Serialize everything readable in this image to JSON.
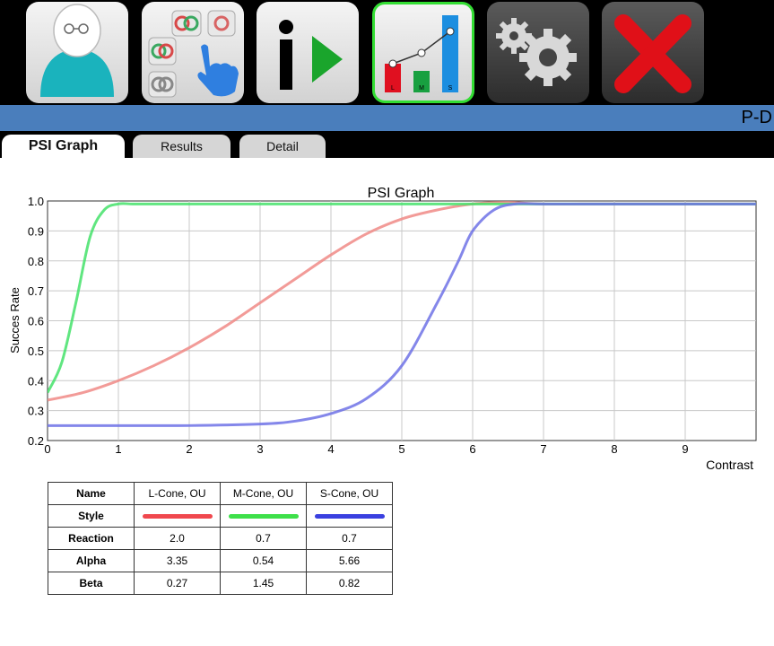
{
  "toolbar": {
    "buttons": [
      {
        "name": "patient-button",
        "icon": "patient-icon"
      },
      {
        "name": "test-select-button",
        "icon": "test-select-icon"
      },
      {
        "name": "info-play-button",
        "icon": "info-play-icon"
      },
      {
        "name": "graph-button",
        "icon": "bar-graph-icon",
        "active": true
      },
      {
        "name": "settings-button",
        "icon": "gears-icon"
      },
      {
        "name": "close-button",
        "icon": "close-icon"
      }
    ],
    "graph_icon_labels": [
      "L",
      "M",
      "S"
    ]
  },
  "header_bar": {
    "text": "P-D"
  },
  "tabs": [
    {
      "label": "PSI Graph",
      "active": true
    },
    {
      "label": "Results"
    },
    {
      "label": "Detail"
    }
  ],
  "colors": {
    "accent_blue": "#4a7ebc",
    "active_border": "#33dd33",
    "l_cone": "#f08a86",
    "m_cone": "#44e26a",
    "s_cone": "#6e72e6"
  },
  "chart_data": {
    "type": "line",
    "title": "PSI Graph",
    "xlabel": "Contrast",
    "ylabel": "Succes Rate",
    "xlim": [
      0,
      10
    ],
    "ylim": [
      0.2,
      1.0
    ],
    "xticks": [
      "0",
      "1",
      "2",
      "3",
      "4",
      "5",
      "6",
      "7",
      "8",
      "9"
    ],
    "yticks": [
      "0.2",
      "0.3",
      "0.4",
      "0.5",
      "0.6",
      "0.7",
      "0.8",
      "0.9",
      "1.0"
    ],
    "grid": true,
    "series": [
      {
        "name": "L-Cone, OU",
        "color": "#f08a86",
        "x": [
          0,
          0.5,
          1,
          1.5,
          2,
          2.5,
          3,
          3.5,
          4,
          4.5,
          5,
          5.5,
          6,
          6.5,
          7,
          8,
          10
        ],
        "y": [
          0.335,
          0.36,
          0.4,
          0.45,
          0.51,
          0.58,
          0.66,
          0.74,
          0.82,
          0.89,
          0.94,
          0.97,
          0.99,
          0.995,
          0.99,
          0.99,
          0.99
        ]
      },
      {
        "name": "M-Cone, OU",
        "color": "#44e26a",
        "x": [
          0,
          0.2,
          0.4,
          0.6,
          0.8,
          1,
          1.2,
          1.5,
          2,
          4,
          6,
          8,
          10
        ],
        "y": [
          0.36,
          0.46,
          0.66,
          0.88,
          0.97,
          0.99,
          0.99,
          0.99,
          0.99,
          0.99,
          0.99,
          0.99,
          0.99
        ]
      },
      {
        "name": "S-Cone, OU",
        "color": "#6e72e6",
        "x": [
          0,
          1,
          2,
          3,
          3.5,
          4,
          4.5,
          5,
          5.5,
          5.8,
          6,
          6.3,
          6.6,
          7,
          8,
          10
        ],
        "y": [
          0.25,
          0.25,
          0.25,
          0.255,
          0.265,
          0.29,
          0.34,
          0.45,
          0.66,
          0.8,
          0.9,
          0.97,
          0.99,
          0.99,
          0.99,
          0.99
        ]
      }
    ]
  },
  "params_table": {
    "header": [
      "Name",
      "L-Cone, OU",
      "M-Cone, OU",
      "S-Cone, OU"
    ],
    "style_label": "Style",
    "rows": [
      {
        "label": "Reaction",
        "values": [
          "2.0",
          "0.7",
          "0.7"
        ]
      },
      {
        "label": "Alpha",
        "values": [
          "3.35",
          "0.54",
          "5.66"
        ]
      },
      {
        "label": "Beta",
        "values": [
          "0.27",
          "1.45",
          "0.82"
        ]
      }
    ]
  }
}
